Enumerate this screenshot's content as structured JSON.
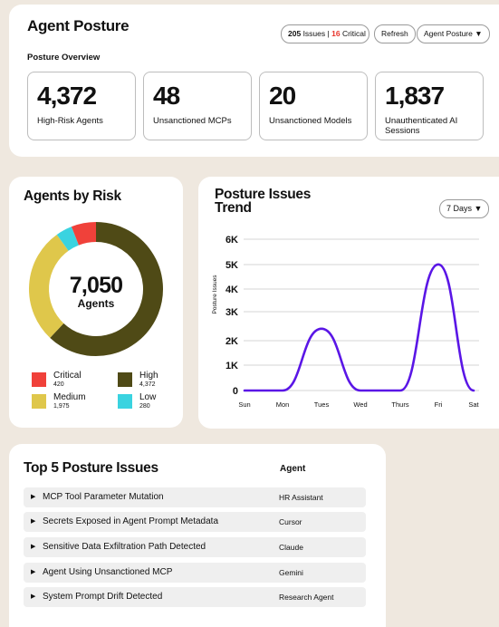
{
  "posture": {
    "title": "Agent Posture",
    "issues_count": "205",
    "issues_word": "Issues",
    "separator": "|",
    "critical_count": "16",
    "critical_word": "Critical",
    "refresh_label": "Refresh",
    "view_dropdown": "Agent Posture",
    "overview_label": "Posture Overview",
    "metrics": [
      {
        "value": "4,372",
        "label": "High-Risk Agents"
      },
      {
        "value": "48",
        "label": "Unsanctioned MCPs"
      },
      {
        "value": "20",
        "label": "Unsanctioned Models"
      },
      {
        "value": "1,837",
        "label": "Unauthenticated AI Sessions"
      }
    ]
  },
  "risk": {
    "title": "Agents by Risk",
    "total": "7,050",
    "total_label": "Agents",
    "legend": [
      {
        "name": "Critical",
        "value": "420",
        "color": "#f0413a"
      },
      {
        "name": "High",
        "value": "4,372",
        "color": "#4f4a16"
      },
      {
        "name": "Medium",
        "value": "1,975",
        "color": "#dfc74b"
      },
      {
        "name": "Low",
        "value": "280",
        "color": "#3ad3e0"
      }
    ]
  },
  "trend": {
    "title": "Posture Issues Trend",
    "range_dropdown": "7 Days",
    "line_color": "#5a16e6"
  },
  "chart_data": {
    "type": "line",
    "title": "Posture Issues Trend",
    "xlabel": "",
    "ylabel": "Posture Issues",
    "x": [
      "Sun",
      "Mon",
      "Tues",
      "Wed",
      "Thurs",
      "Fri",
      "Sat"
    ],
    "y_ticks": [
      "0",
      "1K",
      "2K",
      "3K",
      "4K",
      "5K",
      "6K"
    ],
    "ylim": [
      0,
      6000
    ],
    "grid": true,
    "series": [
      {
        "values": [
          0,
          0,
          2450,
          0,
          0,
          5000,
          0
        ]
      }
    ]
  },
  "top5": {
    "title": "Top 5 Posture Issues",
    "agent_header": "Agent",
    "rows": [
      {
        "issue": "MCP Tool Parameter Mutation",
        "agent": "HR Assistant"
      },
      {
        "issue": "Secrets Exposed in Agent Prompt Metadata",
        "agent": "Cursor"
      },
      {
        "issue": "Sensitive Data Exfiltration Path Detected",
        "agent": "Claude"
      },
      {
        "issue": "Agent Using Unsanctioned MCP",
        "agent": "Gemini"
      },
      {
        "issue": "System Prompt Drift Detected",
        "agent": "Research Agent"
      }
    ]
  }
}
